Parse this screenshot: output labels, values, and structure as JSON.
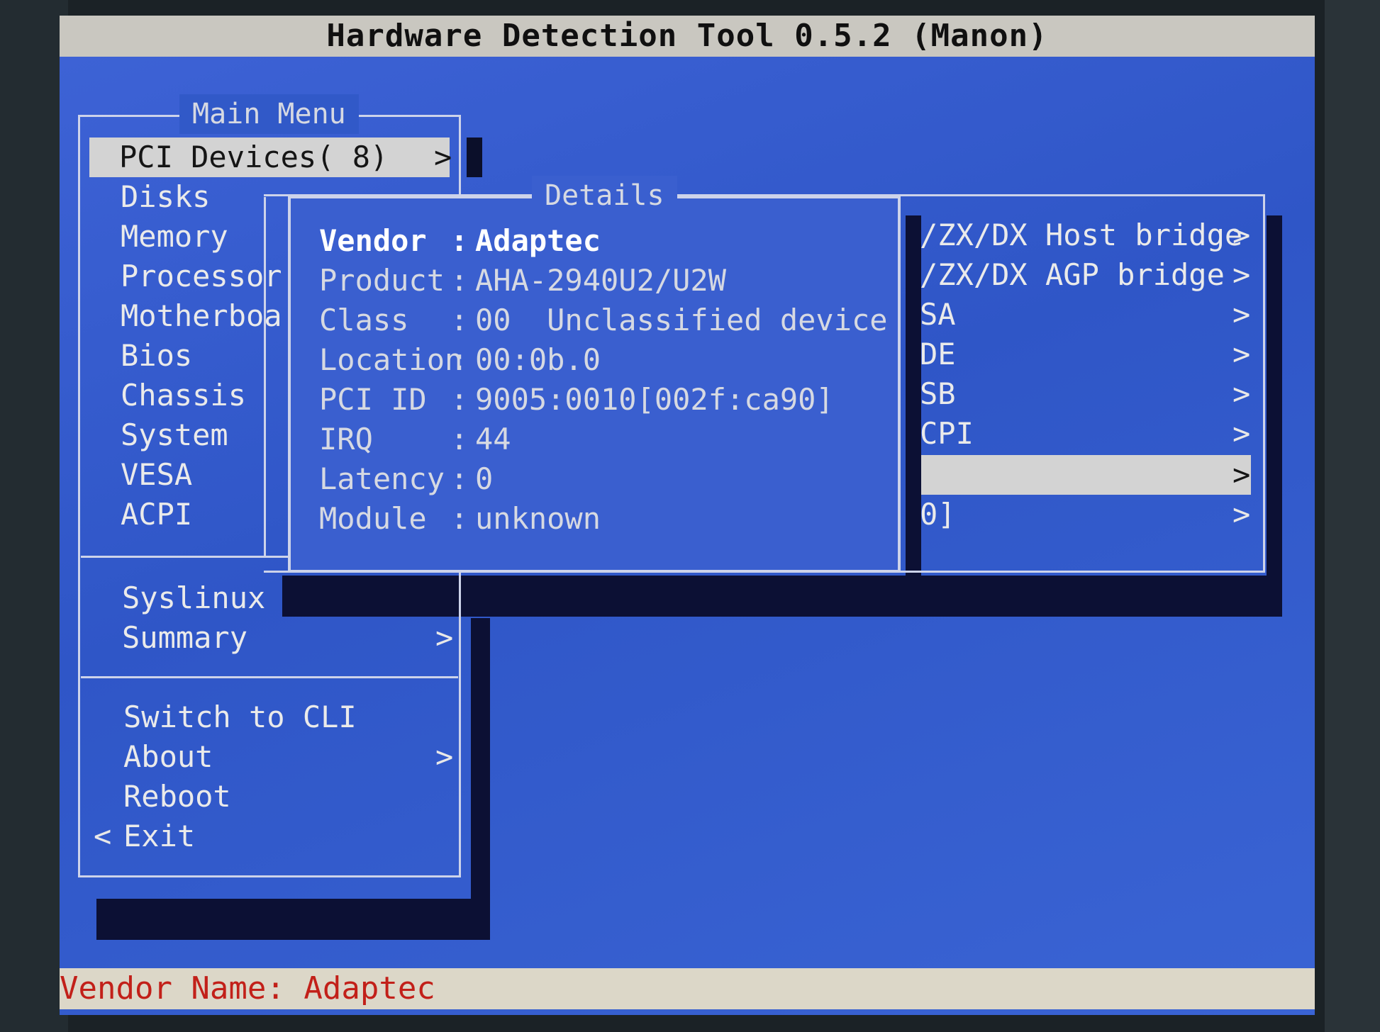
{
  "app_title": "Hardware Detection Tool 0.5.2 (Manon)",
  "main_menu": {
    "title": "Main Menu",
    "selected": {
      "label": "PCI Devices( 8)",
      "arrow": ">"
    },
    "items": [
      "Disks",
      "Memory",
      "Processor",
      "Motherboa",
      "Bios",
      "Chassis",
      "System",
      "VESA",
      "ACPI"
    ],
    "group2": [
      {
        "label": "Syslinux",
        "arrow": ""
      },
      {
        "label": "Summary",
        "arrow": ">"
      }
    ],
    "group3": [
      {
        "label": "Switch to CLI",
        "arrow": ""
      },
      {
        "label": "About",
        "arrow": ">"
      },
      {
        "label": "Reboot",
        "arrow": ""
      },
      {
        "label": "Exit",
        "prefix": "<"
      }
    ]
  },
  "details": {
    "title": "Details",
    "rows": [
      {
        "key": "Vendor",
        "value": "Adaptec"
      },
      {
        "key": "Product",
        "value": "AHA-2940U2/U2W"
      },
      {
        "key": "Class",
        "value": "00  Unclassified device"
      },
      {
        "key": "Location",
        "value": "00:0b.0"
      },
      {
        "key": "PCI ID",
        "value": "9005:0010[002f:ca90]"
      },
      {
        "key": "IRQ",
        "value": "44"
      },
      {
        "key": "Latency",
        "value": "0"
      },
      {
        "key": "Module",
        "value": "unknown"
      }
    ]
  },
  "pci_list": {
    "items": [
      {
        "label": "/ZX/DX Host bridge",
        "arrow": ">"
      },
      {
        "label": "/ZX/DX AGP bridge",
        "arrow": ">"
      },
      {
        "label": "SA",
        "arrow": ">"
      },
      {
        "label": "DE",
        "arrow": ">"
      },
      {
        "label": "SB",
        "arrow": ">"
      },
      {
        "label": "CPI",
        "arrow": ">"
      },
      {
        "label": "",
        "arrow": ">"
      },
      {
        "label": "0]",
        "arrow": ">"
      }
    ]
  },
  "status": "Vendor Name: Adaptec",
  "colors": {
    "screen_bg": "#3159c8",
    "title_bg": "#c9c7c0",
    "status_text": "#c22019",
    "selection": "#d3d3d3",
    "shadow": "#0c1034"
  }
}
